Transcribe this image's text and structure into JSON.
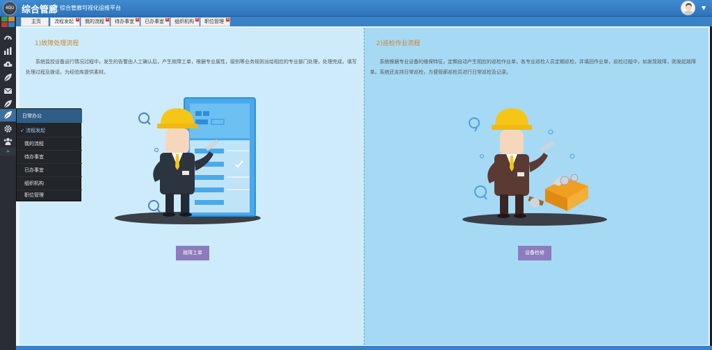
{
  "header": {
    "logo_text": "4GU",
    "app_title": "综合管廊",
    "separator": "|",
    "app_subtitle": "综合管廊可视化运维平台",
    "user_caret": "▼"
  },
  "sidebar": {
    "tiles": [
      "#3c9a4c",
      "#e0872b",
      "#b83a3a",
      "#2f7fc4"
    ],
    "icons": [
      "dashboard-icon",
      "bar-chart-icon",
      "cloud-upload-icon",
      "leaf-icon",
      "envelope-icon",
      "leaf-icon",
      "leaf-icon",
      "gear-icon",
      "users-icon"
    ],
    "expand": "»"
  },
  "tabs": [
    {
      "label": "主页"
    },
    {
      "label": "流程发起"
    },
    {
      "label": "我的流程"
    },
    {
      "label": "待办事宜"
    },
    {
      "label": "已办事宜"
    },
    {
      "label": "组织机构"
    },
    {
      "label": "职位管理"
    }
  ],
  "flyout": {
    "title": "日常办公",
    "items": [
      {
        "label": "流程发起"
      },
      {
        "label": "我的流程"
      },
      {
        "label": "待办事宜"
      },
      {
        "label": "已办事宜"
      },
      {
        "label": "组织机构"
      },
      {
        "label": "职位管理"
      }
    ]
  },
  "panels": {
    "left": {
      "title": "1)故障处理流程",
      "description": "系统监控设备运行情况过程中，发生的告警由人工确认后，产生故障工单，根据专业属性，级别等业务规则派给相应的专业部门处理，处理完成，填写处理过程及拨话，为经验库提供素材。",
      "button": "故障工单"
    },
    "right": {
      "title": "2)巡检作业流程",
      "description": "系统根据专业设备的维保特征，定期自动产生相应的巡检作业单，各专业巡检人员定期巡检，并填回作业单，巡检过程中，如发现故障，则发起故障单。系统还支持日常巡检，方便管廊巡检员进行日常巡检及记录。",
      "button": "设备检修"
    }
  },
  "colors": {
    "header": "#2e74bb",
    "accent_title": "#c9862f",
    "button": "#8d7bbd",
    "left_panel": "#cdebfb",
    "right_panel": "#a6d9f4"
  }
}
